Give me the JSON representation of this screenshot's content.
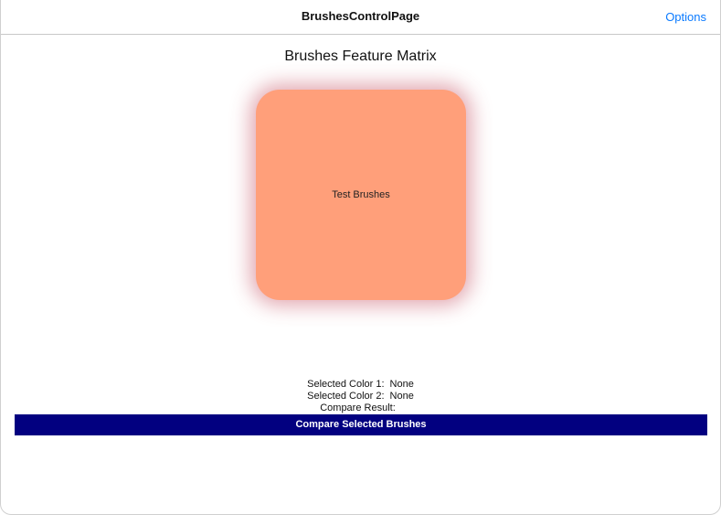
{
  "navbar": {
    "title": "BrushesControlPage",
    "options_label": "Options"
  },
  "main": {
    "title": "Brushes Feature Matrix",
    "brush_box": {
      "label": "Test Brushes",
      "fill_color": "#ff9f7a",
      "shadow_color": "#be3c50"
    },
    "info": {
      "color1_label": "Selected Color 1:",
      "color1_value": "None",
      "color2_label": "Selected Color 2:",
      "color2_value": "None",
      "compare_label": "Compare Result:",
      "compare_value": ""
    },
    "compare_button_label": "Compare Selected Brushes",
    "compare_button_color": "#020080"
  },
  "theme": {
    "accent": "#0a7aff"
  }
}
